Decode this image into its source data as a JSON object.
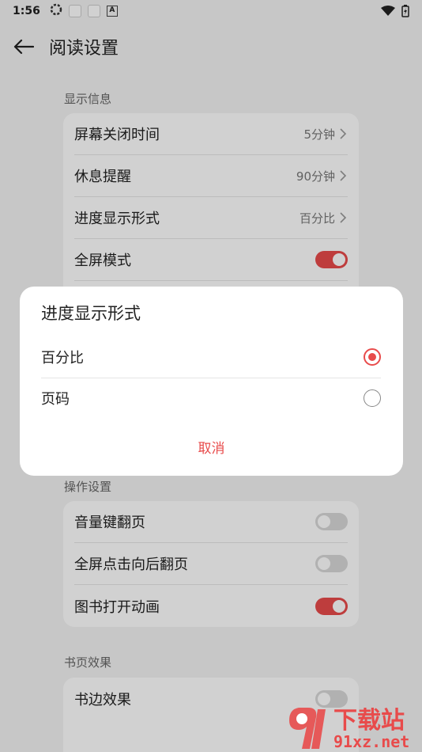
{
  "statusbar": {
    "time": "1:56",
    "a_icon_letter": "A"
  },
  "header": {
    "title": "阅读设置"
  },
  "sections": {
    "display_info": {
      "label": "显示信息",
      "rows": [
        {
          "label": "屏幕关闭时间",
          "value": "5分钟"
        },
        {
          "label": "休息提醒",
          "value": "90分钟"
        },
        {
          "label": "进度显示形式",
          "value": "百分比"
        },
        {
          "label": "全屏模式",
          "toggle": true
        }
      ]
    },
    "operation": {
      "label": "操作设置",
      "rows": [
        {
          "label": "音量键翻页",
          "toggle": false
        },
        {
          "label": "全屏点击向后翻页",
          "toggle": false
        },
        {
          "label": "图书打开动画",
          "toggle": true
        }
      ]
    },
    "page_effect": {
      "label": "书页效果",
      "rows": [
        {
          "label": "书边效果",
          "toggle": false
        }
      ]
    }
  },
  "dialog": {
    "title": "进度显示形式",
    "options": [
      {
        "label": "百分比",
        "selected": true
      },
      {
        "label": "页码",
        "selected": false
      }
    ],
    "cancel_label": "取消"
  },
  "watermark": {
    "brand": "下载站",
    "domain": "91xz.net"
  },
  "colors": {
    "accent": "#e84b4b"
  }
}
